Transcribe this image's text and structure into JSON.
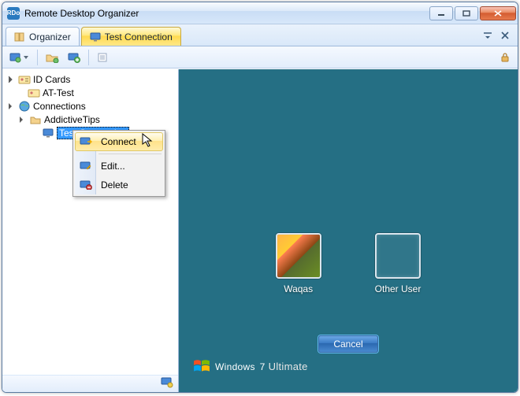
{
  "app": {
    "title": "Remote Desktop Organizer",
    "icon_label": "RDo"
  },
  "tabs": {
    "organizer": "Organizer",
    "test_connection": "Test Connection"
  },
  "tree": {
    "id_cards": "ID Cards",
    "at_test": "AT-Test",
    "connections": "Connections",
    "addictivetips": "AddictiveTips",
    "test_connection": "Test Connection"
  },
  "context_menu": {
    "connect": "Connect",
    "edit": "Edit...",
    "delete": "Delete"
  },
  "remote": {
    "user1": "Waqas",
    "user2": "Other User",
    "cancel": "Cancel",
    "brand_windows": "Windows",
    "brand_seven": "7",
    "brand_edition": "Ultimate"
  }
}
